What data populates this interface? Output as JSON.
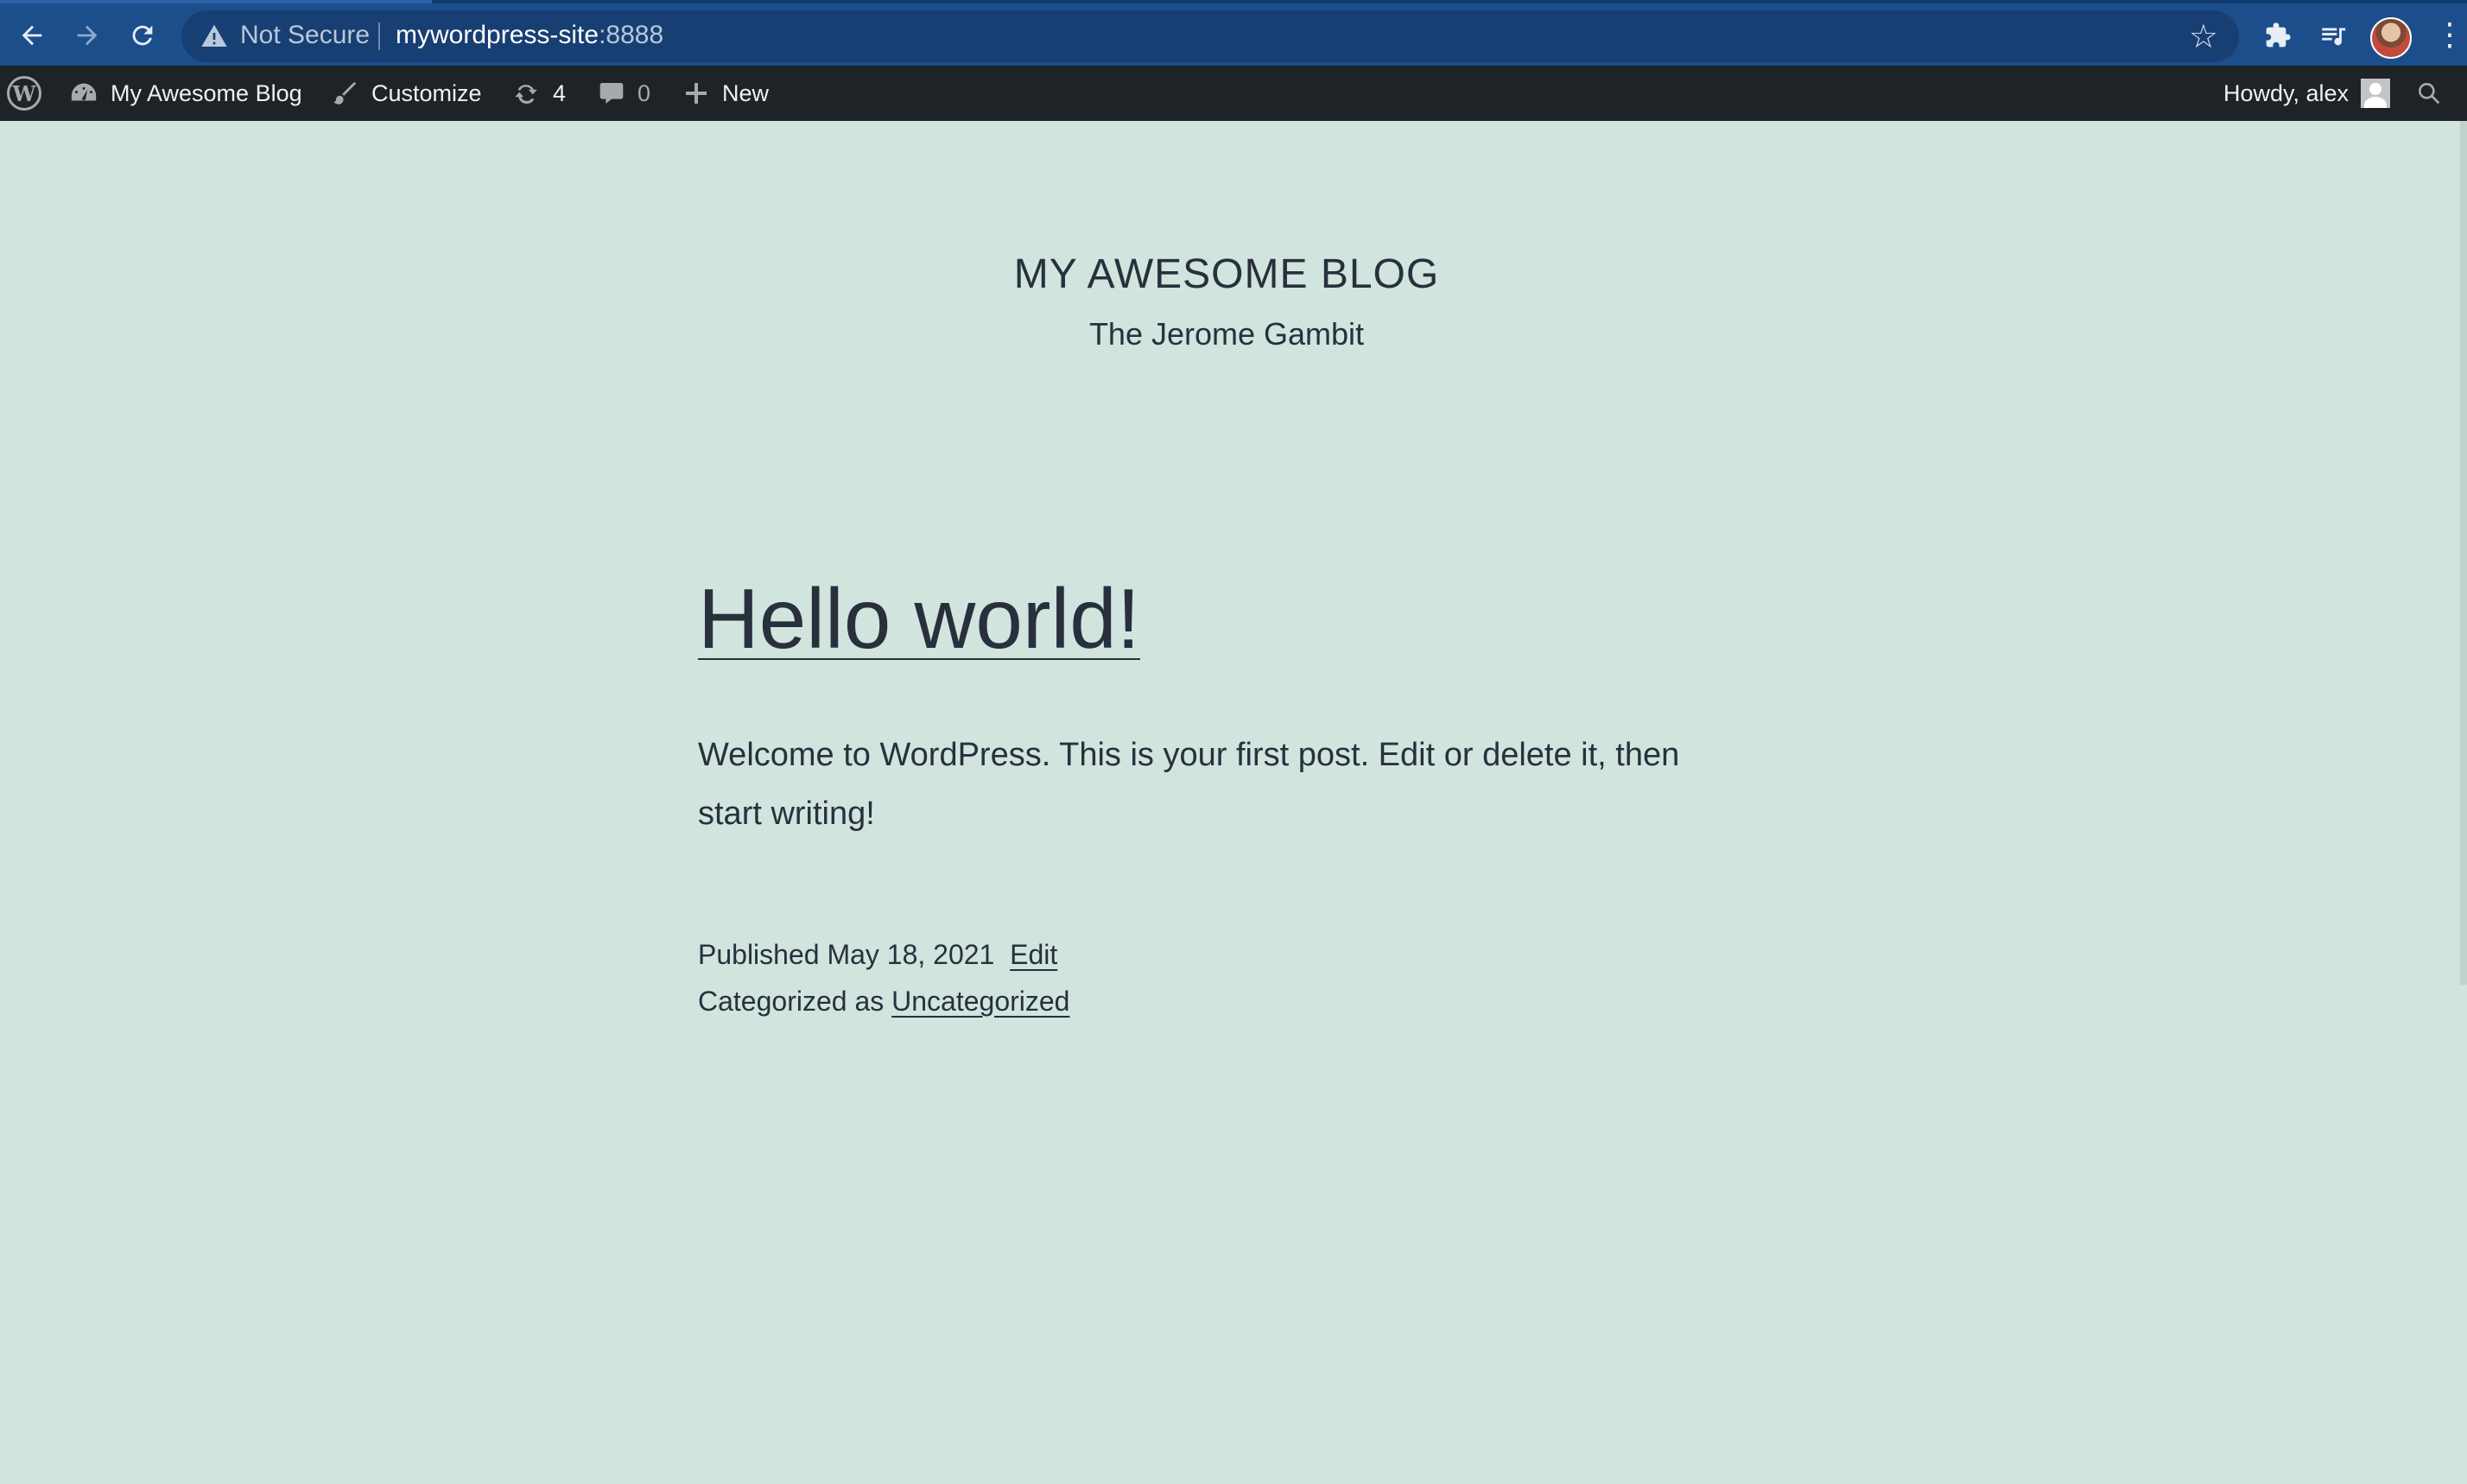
{
  "browser": {
    "security_label": "Not Secure",
    "url_host": "mywordpress-site",
    "url_port": ":8888",
    "icons": [
      "back-arrow-icon",
      "forward-arrow-icon",
      "reload-icon",
      "warning-icon",
      "star-icon",
      "extensions-icon",
      "media-icon",
      "profile-avatar",
      "menu-icon"
    ]
  },
  "adminbar": {
    "site_name": "My Awesome Blog",
    "customize": "Customize",
    "updates_count": "4",
    "comments_count": "0",
    "new_label": "New",
    "howdy": "Howdy, alex"
  },
  "site": {
    "title": "MY AWESOME BLOG",
    "description": "The Jerome Gambit"
  },
  "post": {
    "title": "Hello world!",
    "body": "Welcome to WordPress. This is your first post. Edit or delete it, then start writing!",
    "published_prefix": "Published",
    "date": "May 18, 2021",
    "edit_label": "Edit",
    "categorized_prefix": "Categorized as",
    "category": "Uncategorized"
  },
  "colors": {
    "page_background": "#d1e4dd",
    "text": "#28303d",
    "adminbar_background": "#1d2327",
    "browser_bar": "#1d4e8c"
  }
}
